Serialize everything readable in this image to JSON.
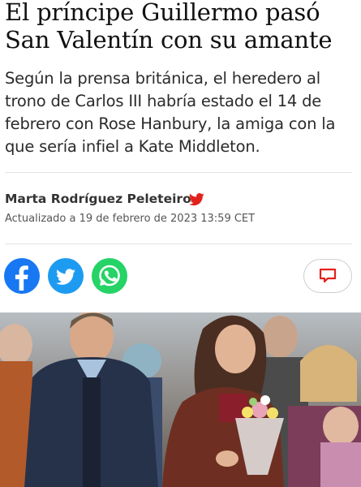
{
  "article": {
    "headline": "El príncipe Guillermo pasó San Valentín con su amante",
    "subtitle": "Según la prensa británica, el heredero al trono de Carlos III habría estado el 14 de febrero con Rose Hanbury, la amiga con la que sería infiel a Kate Middleton.",
    "author": "Marta Rodríguez Peleteiro",
    "updated": "Actualizado a 19 de febrero de 2023 13:59 CET"
  },
  "share": {
    "icons": [
      "facebook-icon",
      "twitter-icon",
      "whatsapp-icon",
      "comment-icon"
    ]
  },
  "colors": {
    "facebook": "#1877f2",
    "twitter": "#1d9bf0",
    "whatsapp": "#25d366",
    "accent_red": "#e2211c"
  }
}
